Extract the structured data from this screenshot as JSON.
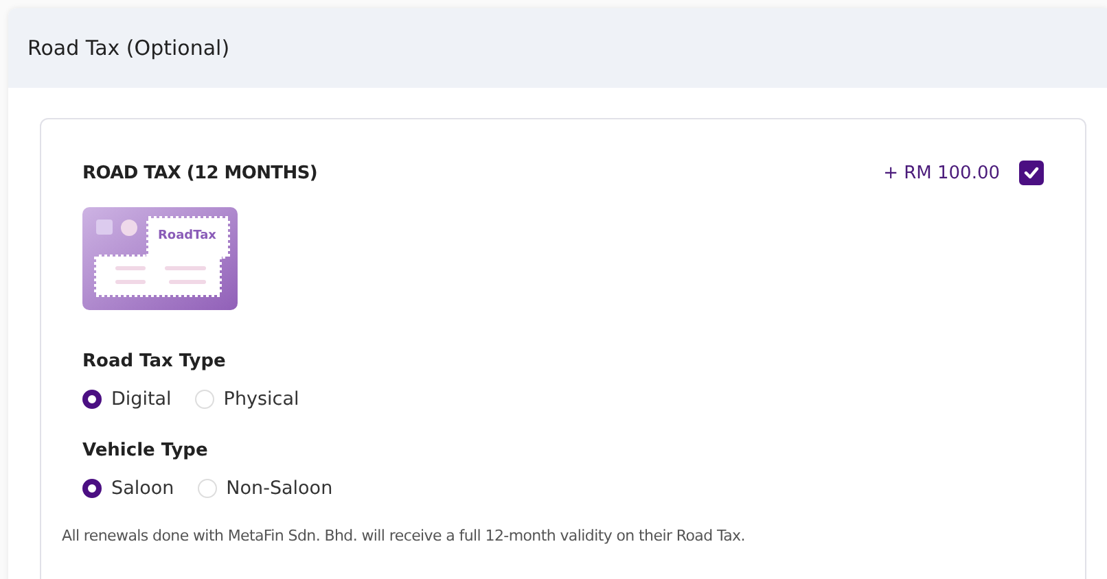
{
  "section": {
    "title": "Road Tax (Optional)"
  },
  "product": {
    "title": "ROAD TAX (12 MONTHS)",
    "price": "+ RM 100.00",
    "checked": true,
    "illustration_label": "RoadTax"
  },
  "groups": [
    {
      "label": "Road Tax Type",
      "options": [
        {
          "label": "Digital",
          "selected": true
        },
        {
          "label": "Physical",
          "selected": false
        }
      ]
    },
    {
      "label": "Vehicle Type",
      "options": [
        {
          "label": "Saloon",
          "selected": true
        },
        {
          "label": "Non-Saloon",
          "selected": false
        }
      ]
    }
  ],
  "note": "All renewals done with MetaFin Sdn. Bhd. will receive a full 12-month validity on their Road Tax."
}
